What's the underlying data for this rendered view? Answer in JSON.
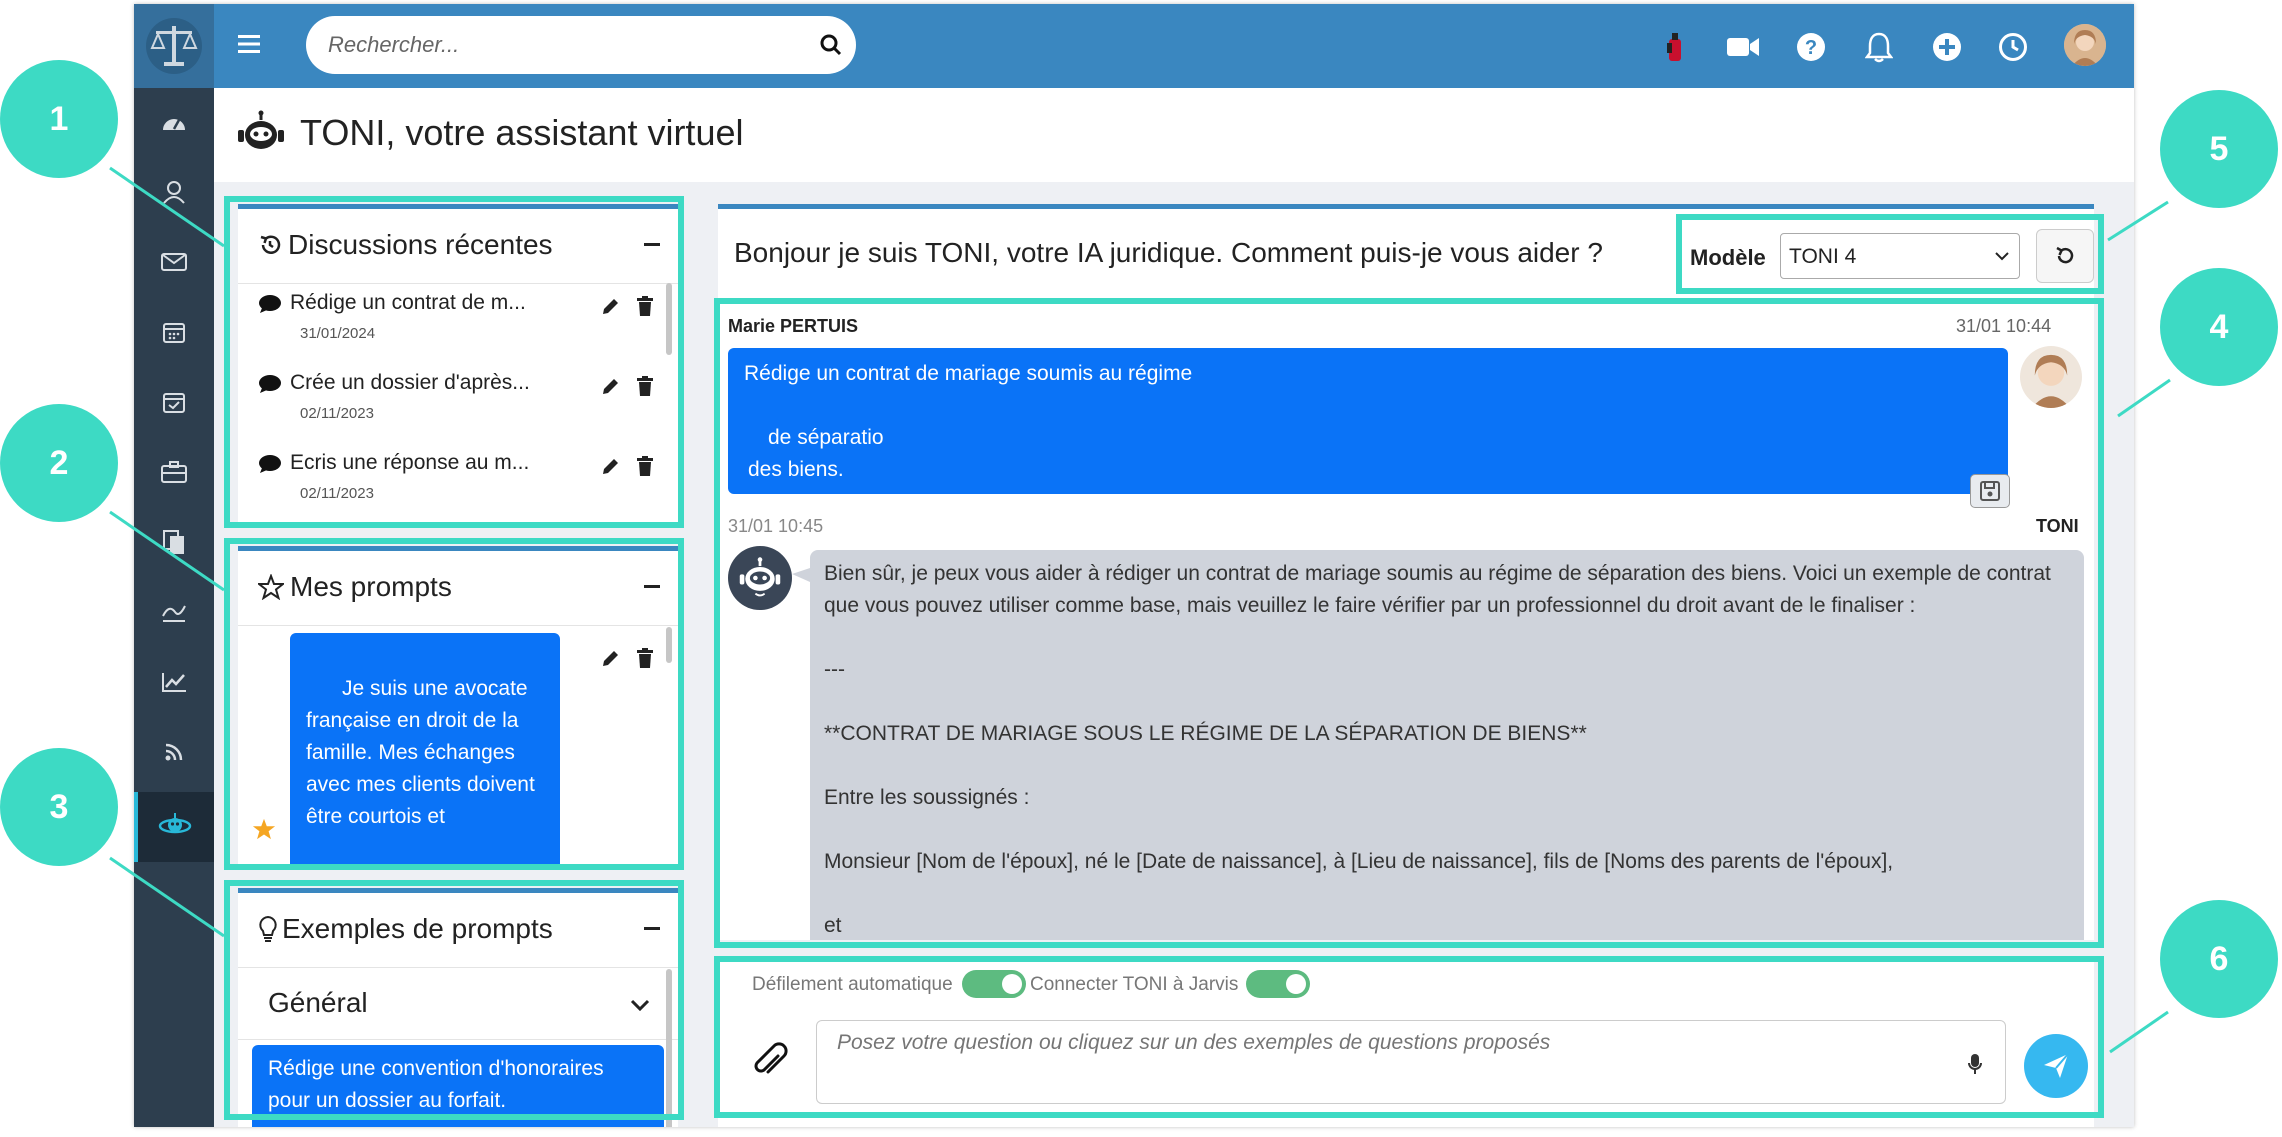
{
  "search": {
    "placeholder": "Rechercher..."
  },
  "page": {
    "title": "TONI, votre assistant virtuel"
  },
  "recent": {
    "title": "Discussions récentes",
    "items": [
      {
        "label": "Rédige un contrat de m...",
        "date": "31/01/2024"
      },
      {
        "label": "Crée un dossier d'après...",
        "date": "02/11/2023"
      },
      {
        "label": "Ecris une réponse au m...",
        "date": "02/11/2023"
      }
    ]
  },
  "prompts": {
    "title": "Mes prompts",
    "item_text": "Je suis une avocate française en droit de la famille. Mes échanges avec mes clients doivent être courtois et"
  },
  "examples": {
    "title": "Exemples de prompts",
    "category": "Général",
    "item": "Rédige une convention d'honoraires pour un dossier au forfait."
  },
  "chat": {
    "greeting": "Bonjour je suis TONI, votre IA juridique. Comment puis-je vous aider ?",
    "model_label": "Modèle",
    "model_value": "TONI 4",
    "model_options": [
      "TONI 4"
    ],
    "user_name": "Marie PERTUIS",
    "user_time": "31/01 10:44",
    "user_message": {
      "line1": "Rédige un contrat de mariage soumis au régime",
      "line2": "de séparatio",
      "line3": "des biens."
    },
    "bot_time": "31/01 10:45",
    "bot_name": "TONI",
    "bot_message": {
      "p1": "Bien sûr, je peux vous aider à rédiger un contrat de mariage soumis au régime de séparation des biens. Voici un exemple de contrat que vous pouvez utiliser comme base, mais veuillez le faire vérifier par un professionnel du droit avant de le finaliser :",
      "p2": "---",
      "p3": "**CONTRAT DE MARIAGE SOUS LE RÉGIME DE LA SÉPARATION DE BIENS**",
      "p4": "Entre les soussignés :",
      "p5": "Monsieur [Nom de l'époux], né le [Date de naissance], à [Lieu de naissance], fils de [Noms des parents de l'époux],",
      "p6": "et"
    }
  },
  "composer": {
    "autoscroll_label": "Défilement automatique",
    "autoscroll_on": true,
    "jarvis_label": "Connecter TONI à Jarvis",
    "jarvis_on": true,
    "placeholder": "Posez votre question ou cliquez sur un des exemples de questions proposés"
  },
  "callouts": [
    "1",
    "2",
    "3",
    "4",
    "5",
    "6"
  ],
  "colors": {
    "topbar": "#3a87c0",
    "sidebar": "#2d3e4e",
    "accent_blue": "#0a73f7",
    "highlight_teal": "#3ddac4",
    "bot_bubble": "#cfd3db",
    "toggle_on": "#5dbb80"
  }
}
